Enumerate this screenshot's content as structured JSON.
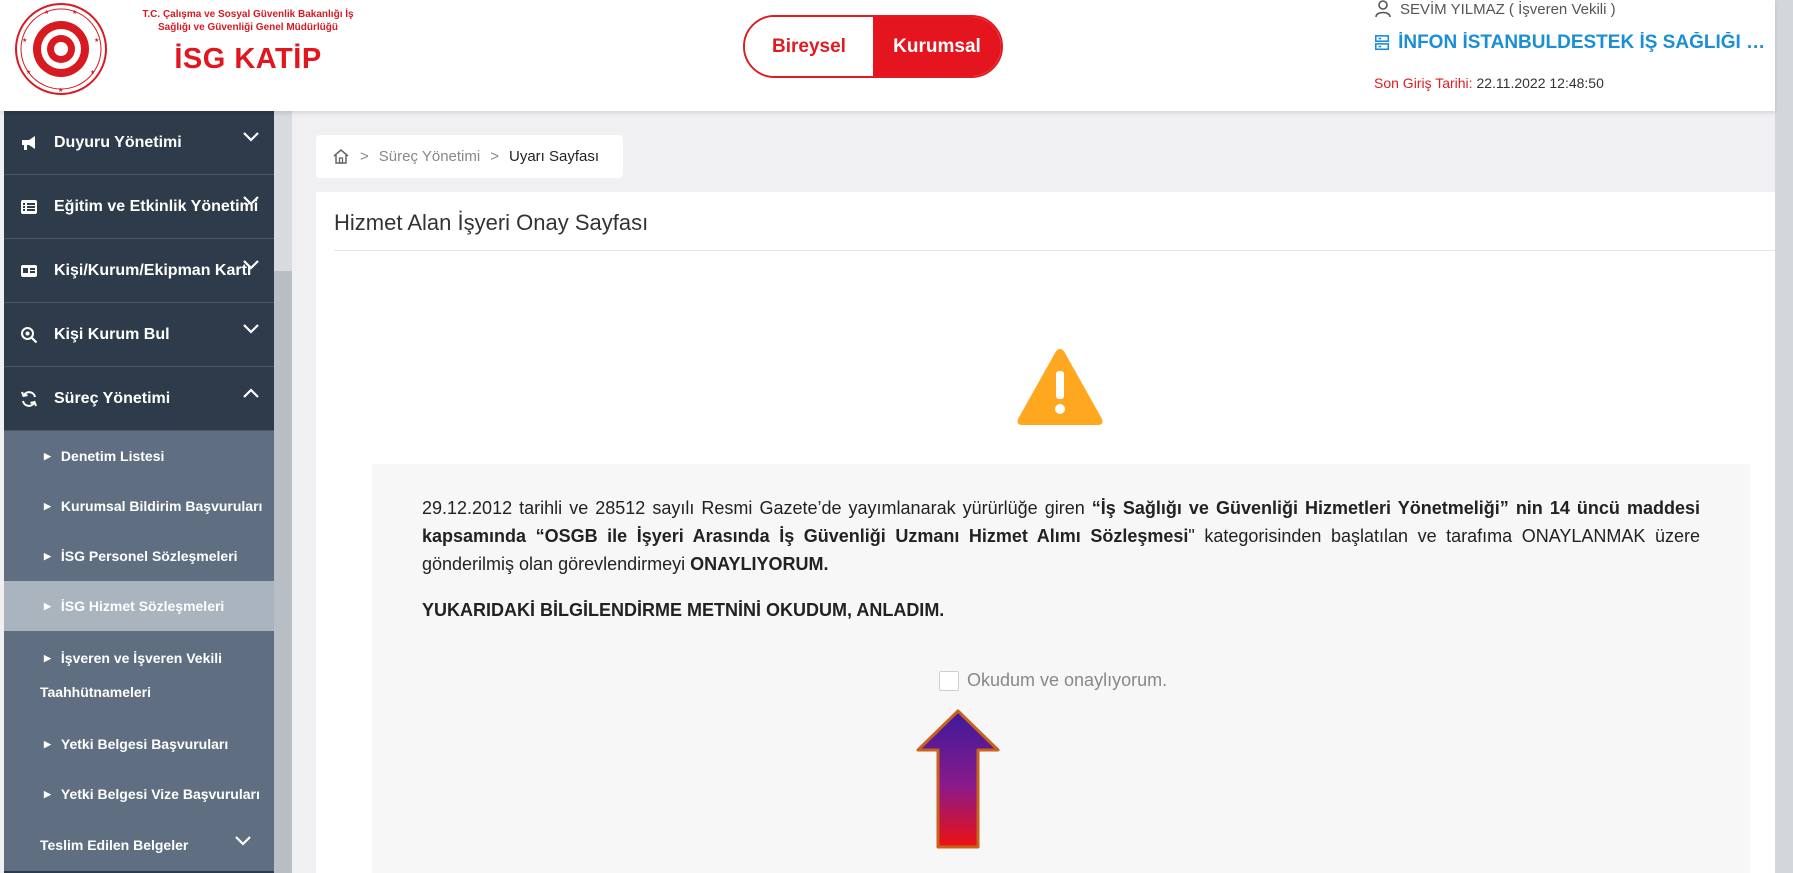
{
  "header": {
    "ministry_line1": "T.C. Çalışma ve Sosyal Güvenlik Bakanlığı İş",
    "ministry_line2": "Sağlığı ve Güvenliği Genel Müdürlüğü",
    "brand": "İSG KATİP",
    "toggle_bireysel": "Bireysel",
    "toggle_kurumsal": "Kurumsal",
    "user": "SEVİM YILMAZ ( İşveren Vekili )",
    "organization": "İNFON İSTANBULDESTEK İŞ SAĞLIĞI VE GÜ...",
    "last_login_label": "Son Giriş Tarihi:",
    "last_login_value": "22.11.2022 12:48:50"
  },
  "sidebar": {
    "items": [
      {
        "label": "Duyuru Yönetimi",
        "icon": "megaphone-icon"
      },
      {
        "label": "Eğitim ve Etkinlik Yönetimi",
        "icon": "list-icon"
      },
      {
        "label": "Kişi/Kurum/Ekipman Kartı",
        "icon": "id-card-icon"
      },
      {
        "label": "Kişi Kurum Bul",
        "icon": "search-icon"
      },
      {
        "label": "Süreç Yönetimi",
        "icon": "refresh-icon"
      }
    ],
    "sub_items": [
      "Denetim Listesi",
      "Kurumsal Bildirim Başvuruları",
      "İSG Personel Sözleşmeleri",
      "İSG Hizmet Sözleşmeleri",
      "İşveren ve İşveren Vekili",
      "Taahhütnameleri",
      "Yetki Belgesi Başvuruları",
      "Yetki Belgesi Vize Başvuruları"
    ],
    "teslim": "Teslim Edilen Belgeler"
  },
  "breadcrumb": {
    "sep": ">",
    "level1": "Süreç Yönetimi",
    "current": "Uyarı Sayfası"
  },
  "page": {
    "title": "Hizmet Alan İşyeri Onay Sayfası",
    "text_part1": "29.12.2012 tarihli ve 28512 sayılı Resmi Gazete’de yayımlanarak yürürlüğe giren ",
    "text_bold1": "“İş Sağlığı ve Güvenliği Hizmetleri Yönetmeliği” nin 14 üncü maddesi kapsamında “OSGB ile İşyeri Arasında İş Güvenliği Uzmanı Hizmet Alımı Sözleşmesi",
    "text_part2": "\" kategorisinden başlatılan ve tarafıma ONAYLANMAK üzere gönderilmiş olan görevlendirmeyi ",
    "text_bold2": "ONAYLIYORUM.",
    "ack": "YUKARIDAKİ BİLGİLENDİRME METNİNİ OKUDUM, ANLADIM.",
    "consent_label": "Okudum ve onaylıyorum."
  },
  "colors": {
    "brand_red": "#e4151e",
    "link_blue": "#1a8fd6",
    "sidebar_dark": "#2e3b4a",
    "warning_orange": "#ffa81f"
  }
}
